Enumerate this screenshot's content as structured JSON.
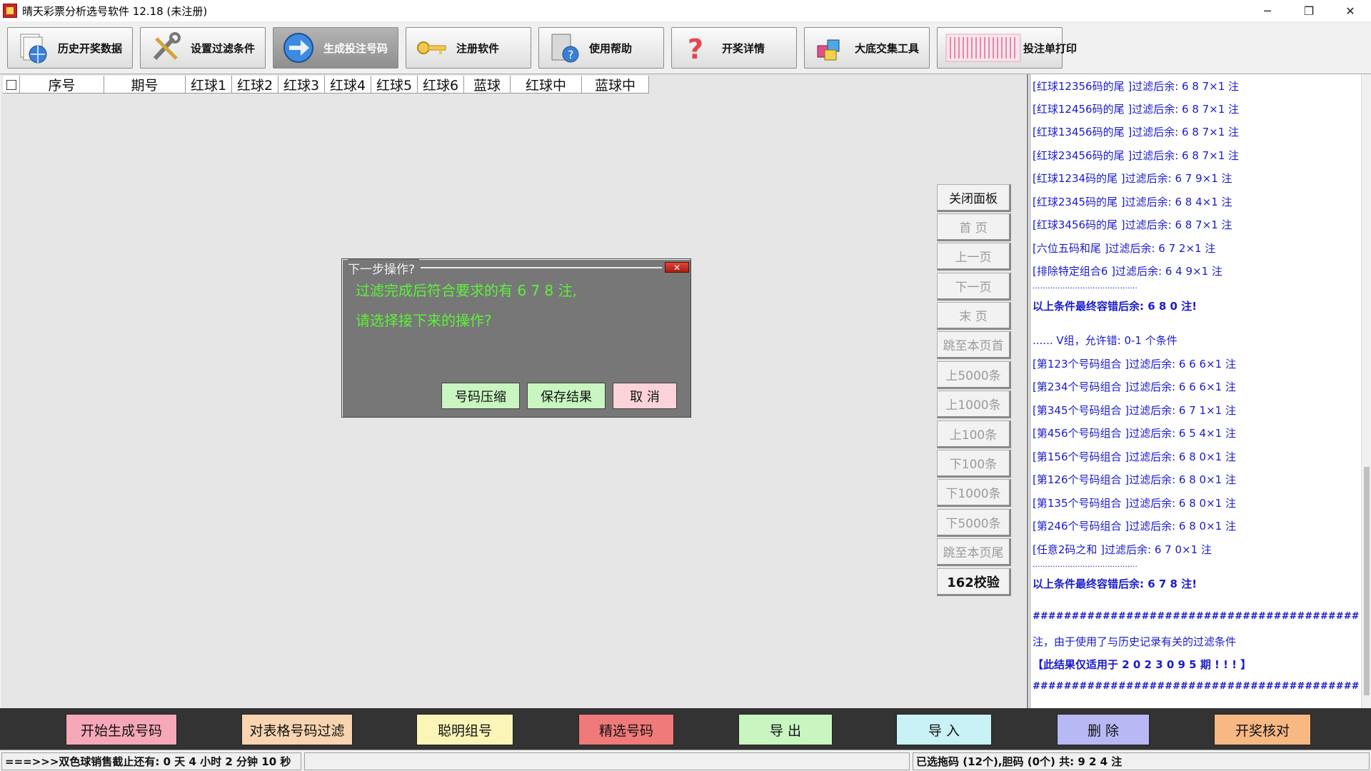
{
  "window": {
    "title": "晴天彩票分析选号软件 12.18 (未注册)",
    "minimize_glyph": "─",
    "maximize_glyph": "❐",
    "close_glyph": "✕"
  },
  "toolbar": {
    "buttons": [
      {
        "label": "历史开奖数据",
        "icon": "globe-documents-icon"
      },
      {
        "label": "设置过滤条件",
        "icon": "tools-icon"
      },
      {
        "label": "生成投注号码",
        "icon": "arrow-right-icon"
      },
      {
        "label": "注册软件",
        "icon": "key-icon"
      },
      {
        "label": "使用帮助",
        "icon": "help-book-icon"
      },
      {
        "label": "开奖详情",
        "icon": "question-mark-icon"
      },
      {
        "label": "大底交集工具",
        "icon": "cubes-icon"
      },
      {
        "label": "投注单打印",
        "icon": "ticket-print-icon"
      }
    ]
  },
  "table": {
    "headers": [
      "序号",
      "期号",
      "红球1",
      "红球2",
      "红球3",
      "红球4",
      "红球5",
      "红球6",
      "蓝球",
      "红球中",
      "蓝球中"
    ]
  },
  "nav": {
    "buttons": [
      "关闭面板",
      "首 页",
      "上一页",
      "下一页",
      "末 页",
      "跳至本页首",
      "上5000条",
      "上1000条",
      "上100条",
      "下100条",
      "下1000条",
      "下5000条",
      "跳至本页尾",
      "162校验"
    ]
  },
  "log": {
    "lines": [
      "[红球12356码的尾 ]过滤后余: 6 8 7×1 注",
      "[红球12456码的尾 ]过滤后余: 6 8 7×1 注",
      "[红球13456码的尾 ]过滤后余: 6 8 7×1 注",
      "[红球23456码的尾 ]过滤后余: 6 8 7×1 注",
      "[红球1234码的尾 ]过滤后余: 6 7 9×1 注",
      "[红球2345码的尾 ]过滤后余: 6 8 4×1 注",
      "[红球3456码的尾 ]过滤后余: 6 8 7×1 注",
      "[六位五码和尾 ]过滤后余: 6 7 2×1 注",
      "[排除特定组合6 ]过滤后余: 6 4 9×1 注",
      "..........................................",
      "以上条件最终容错后余: 6 8 0 注!",
      "...... V组，允许错: 0-1 个条件",
      "[第123个号码组合 ]过滤后余: 6 6 6×1 注",
      "[第234个号码组合 ]过滤后余: 6 6 6×1 注",
      "[第345个号码组合 ]过滤后余: 6 7 1×1 注",
      "[第456个号码组合 ]过滤后余: 6 5 4×1 注",
      "[第156个号码组合 ]过滤后余: 6 8 0×1 注",
      "[第126个号码组合 ]过滤后余: 6 8 0×1 注",
      "[第135个号码组合 ]过滤后余: 6 8 0×1 注",
      "[第246个号码组合 ]过滤后余: 6 8 0×1 注",
      "[任意2码之和 ]过滤后余: 6 7 0×1 注",
      "..........................................",
      "以上条件最终容错后余: 6 7 8 注!",
      "##########################################",
      "注，由于使用了与历史记录有关的过滤条件",
      "【此结果仅适用于 2 0 2 3 0 9 5 期 ! ! ! 】",
      "##########################################"
    ]
  },
  "dialog": {
    "title": "下一步操作?",
    "close_glyph": "✕",
    "message_line1": "过滤完成后符合要求的有 6 7 8 注,",
    "message_line2": "请选择接下来的操作?",
    "buttons": [
      "号码压缩",
      "保存结果",
      "取 消"
    ],
    "button_colors": [
      "#c8f5c0",
      "#c8f5c0",
      "#fbd3d8"
    ]
  },
  "actions": {
    "buttons": [
      "开始生成号码",
      "对表格号码过滤",
      "聪明组号",
      "精选号码",
      "导 出",
      "导 入",
      "删 除",
      "开奖核对"
    ],
    "colors": [
      "#f7a8b8",
      "#f8d4b0",
      "#fbf6b8",
      "#f07a7a",
      "#c8f5c0",
      "#c8f2f5",
      "#b8b8f5",
      "#f7b884"
    ]
  },
  "status": {
    "countdown": "===>>>双色球销售截止还有: 0 天 4 小时 2 分钟 10 秒",
    "middle": "",
    "selection": "已选拖码 (12个),胆码 (0个) 共: 9 2 4 注"
  },
  "colors": {
    "log_text": "#1a1acc",
    "dialog_bg": "#777777",
    "dialog_text": "#5ef03a",
    "action_bar": "#333333"
  }
}
